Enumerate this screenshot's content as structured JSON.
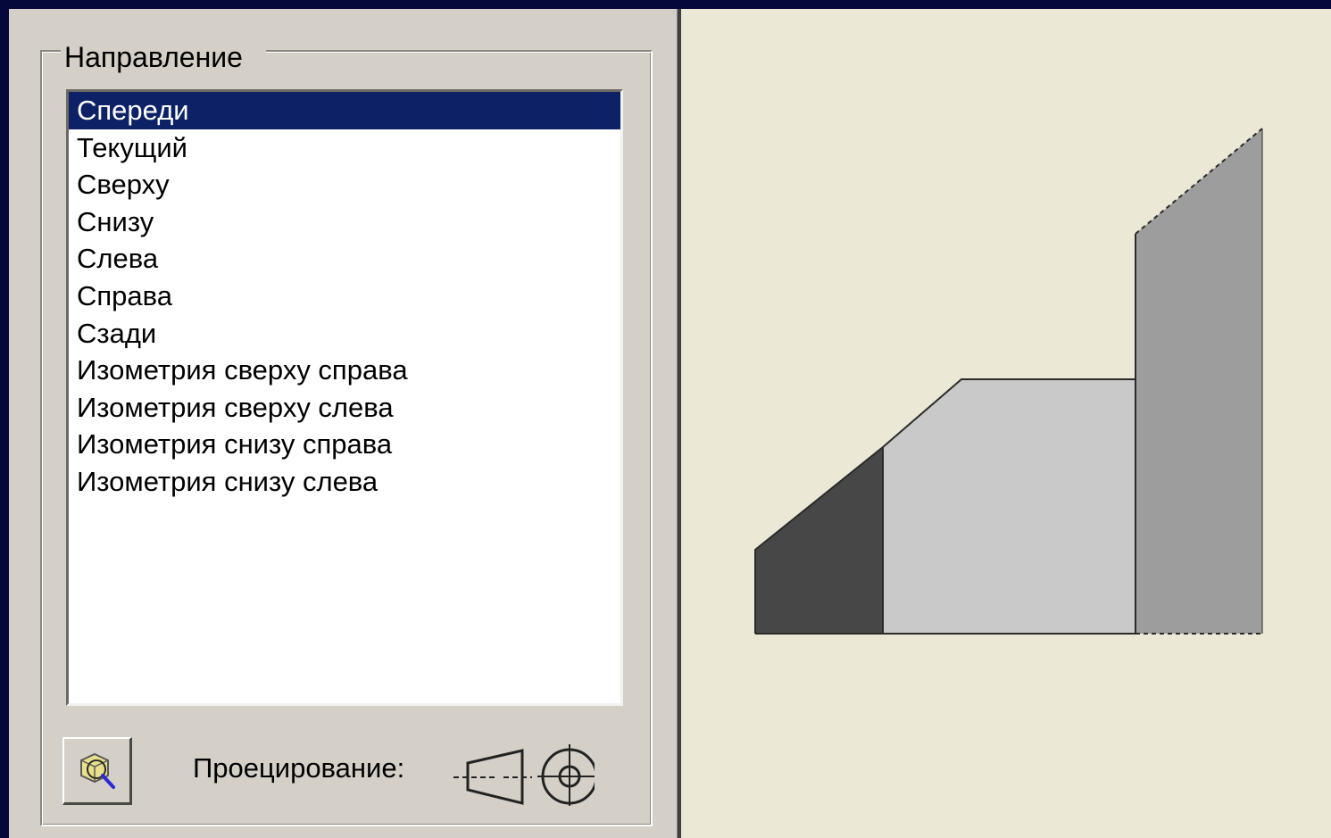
{
  "direction_group": {
    "title": "Направление",
    "items": [
      {
        "label": "Спереди",
        "selected": true
      },
      {
        "label": "Текущий",
        "selected": false
      },
      {
        "label": "Сверху",
        "selected": false
      },
      {
        "label": "Снизу",
        "selected": false
      },
      {
        "label": "Слева",
        "selected": false
      },
      {
        "label": "Справа",
        "selected": false
      },
      {
        "label": "Сзади",
        "selected": false
      },
      {
        "label": "Изометрия сверху справа",
        "selected": false
      },
      {
        "label": "Изометрия сверху слева",
        "selected": false
      },
      {
        "label": "Изометрия снизу справа",
        "selected": false
      },
      {
        "label": "Изометрия снизу слева",
        "selected": false
      }
    ]
  },
  "footer": {
    "view_button_icon": "zoom-view-icon",
    "projection_label": "Проецирование:",
    "projection_icon": "first-angle-projection-icon"
  },
  "preview": {
    "icon": "part-front-view-preview"
  },
  "colors": {
    "background": "#04083a",
    "panel": "#d4d0c8",
    "preview_background": "#ebe8d5",
    "selection": "#0d2266",
    "face_dark": "#474747",
    "face_light": "#c9c9c9",
    "face_mid": "#9d9d9d"
  }
}
